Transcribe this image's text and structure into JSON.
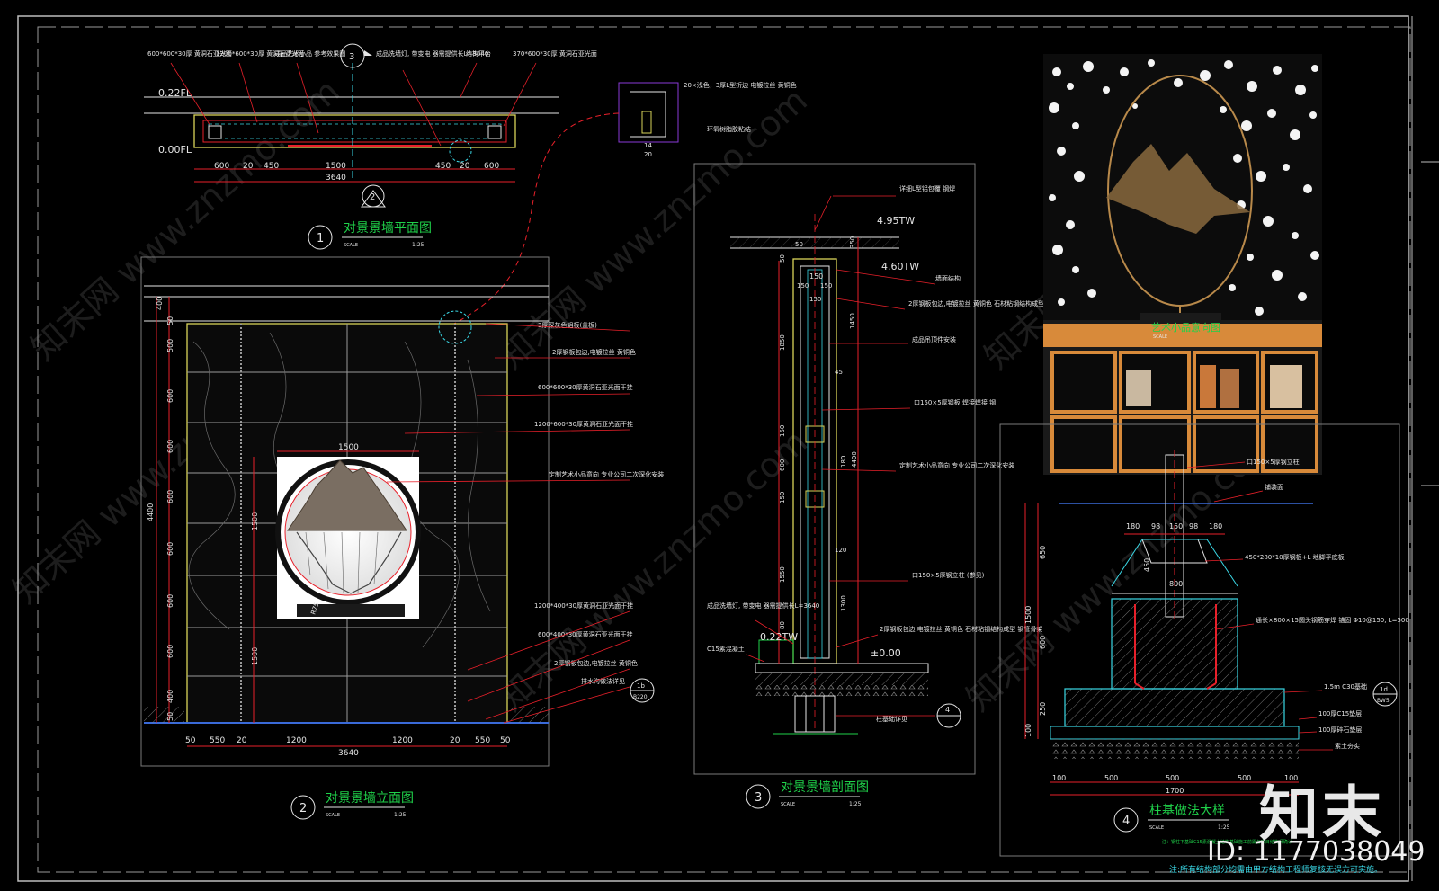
{
  "plan": {
    "num": "1",
    "title": "对景景墙平面图",
    "scale": "SCALE",
    "ratio": "1:25",
    "lv_top": "0.22FL",
    "lv_bot": "0.00FL",
    "dims": [
      "600",
      "20",
      "450",
      "1500",
      "450",
      "20",
      "600"
    ],
    "total": "3640",
    "callouts": [
      "600*600*30厚 黄洞石亚光面",
      "1200*600*30厚 黄洞石亚光面",
      "成品艺术小品 参考效果图",
      "成品洗墙灯, 带变电 器需提供长L=3640",
      "结构平台",
      "370*600*30厚 黄洞石亚光面"
    ],
    "sec_tag": "3",
    "sec_tag2": "2"
  },
  "detail_small": {
    "notes": [
      "20×浅色，3厚L型折边 电镀拉丝 黄铜色",
      "环氧树脂胶粘结"
    ],
    "d1": "14",
    "d2": "20"
  },
  "elev": {
    "num": "2",
    "title": "对景景墙立面图",
    "scale": "SCALE",
    "ratio": "1:25",
    "top_dim": "1500",
    "total": "3640",
    "dims": [
      "50",
      "550",
      "20",
      "1200",
      "1200",
      "20",
      "550",
      "50"
    ],
    "vdims": [
      "400",
      "50",
      "500",
      "600",
      "600",
      "600",
      "600",
      "600",
      "600",
      "400",
      "50"
    ],
    "vtotal": "4400",
    "art_h": "1500",
    "art_h2": "1500",
    "art_label": "R75",
    "callouts": [
      "3厚深灰色铝板(盖板)",
      "2厚钢板包边,电镀拉丝 黄铜色",
      "600*600*30厚黄洞石亚光面干挂",
      "1200*600*30厚黄洞石亚光面干挂",
      "定制艺术小品意向 专业公司二次深化安装",
      "1200*400*30厚黄洞石亚光面干挂",
      "600*400*30厚黄洞石亚光面干挂",
      "2厚钢板包边,电镀拉丝 黄铜色",
      "排水沟做法详见"
    ],
    "ref_top": "1b",
    "ref_bot": "B220"
  },
  "section": {
    "num": "3",
    "title": "对景景墙剖面图",
    "scale": "SCALE",
    "ratio": "1:25",
    "lv1": "4.95TW",
    "lv2": "4.60TW",
    "lv3": "0.22TW",
    "lv4": "±0.00",
    "dims_top": [
      "50",
      "150",
      "150",
      "150",
      "150"
    ],
    "vdims": [
      "50",
      "1850",
      "150",
      "600",
      "150",
      "1550",
      "80"
    ],
    "rdims": [
      "350",
      "1450",
      "45",
      "180",
      "4400",
      "120",
      "1300"
    ],
    "callouts": [
      "详细L型铝包覆 钢焊",
      "墙面结构",
      "2厚钢板包边,电镀拉丝 黄铜色 石材粘钢结构成型 钢管骨架",
      "成品吊顶件安装",
      "口150×5厚钢板 焊接焊接 钢",
      "定制艺术小品意向 专业公司二次深化安装",
      "口150×5厚钢立柱 (参见)",
      "2厚钢板包边,电镀拉丝 黄铜色 石材粘钢结构成型 钢管骨架",
      "成品洗墙灯, 带变电 器需提供长L=3640",
      "C15素混凝土",
      "柱基础详见"
    ],
    "ref": "4"
  },
  "photo": {
    "label": "艺术小品意向图",
    "sub": "SCALE"
  },
  "footing": {
    "num": "4",
    "title": "柱基做法大样",
    "scale": "SCALE",
    "ratio": "1:25",
    "top_dims": [
      "180",
      "98",
      "150",
      "98",
      "180"
    ],
    "d_mid": "800",
    "d_450": "450",
    "vdims": [
      "650",
      "1500",
      "600",
      "250",
      "100"
    ],
    "bot_dims": [
      "100",
      "500",
      "500",
      "500",
      "100"
    ],
    "bot_total": "1700",
    "callouts": [
      "口150×5厚钢立柱",
      "铺装面",
      "450*280*10厚钢板+L 地脚平底板",
      "通长×800×15圆头钢筋穿焊 锚固 Φ10@150, L=500",
      "1.5m C30基础",
      "100厚C15垫层",
      "100厚碎石垫层",
      "素土夯实"
    ],
    "ref": "1d",
    "ref2": "BW5",
    "note1": "注：钢柱下基础C15素混凝土结构基础施工前需与项目结构师确认",
    "note2": "注:所有结构部分均需由甲方结构工程师复核无误方可实施。"
  },
  "watermark": "知末网 www.znzmo.com",
  "brand": "知末",
  "id_text": "ID: 1177038049",
  "colors": {
    "cyan": "#3ad8e6",
    "red": "#e8202a",
    "green": "#1fd24a",
    "yellow": "#d9d55a",
    "gray": "#9a9a9a",
    "white": "#e6e6e6"
  }
}
